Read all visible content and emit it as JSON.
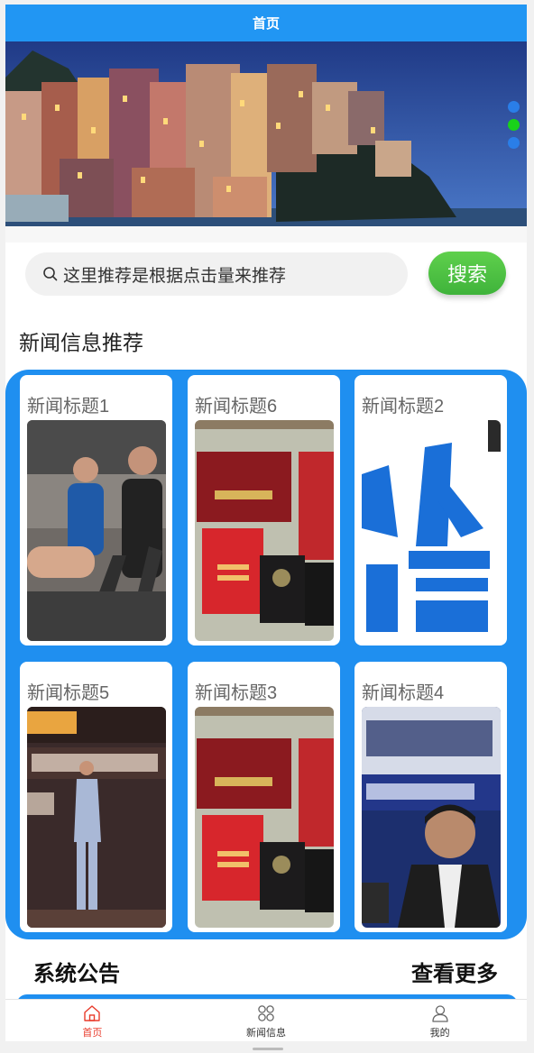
{
  "navbar": {
    "title": "首页"
  },
  "banner": {
    "slide_count": 3,
    "active_index": 1,
    "colors": {
      "active_dot": "#19d219",
      "inactive_dot": "#2a7ee8"
    }
  },
  "search": {
    "placeholder": "这里推荐是根据点击量来推荐",
    "button_label": "搜索",
    "icon": "search-icon"
  },
  "news_section": {
    "title": "新闻信息推荐",
    "items": [
      {
        "title": "新闻标题1",
        "image": "gym-photo"
      },
      {
        "title": "新闻标题6",
        "image": "certificates-photo"
      },
      {
        "title": "新闻标题2",
        "image": "personal-info-text-graphic"
      },
      {
        "title": "新闻标题5",
        "image": "stage-speaker-photo"
      },
      {
        "title": "新闻标题3",
        "image": "certificates-photo"
      },
      {
        "title": "新闻标题4",
        "image": "press-conference-photo"
      }
    ]
  },
  "notice_section": {
    "title": "系统公告",
    "more_label": "查看更多"
  },
  "tabbar": {
    "items": [
      {
        "label": "首页",
        "icon": "home-icon",
        "active": true
      },
      {
        "label": "新闻信息",
        "icon": "grid-icon",
        "active": false
      },
      {
        "label": "我的",
        "icon": "user-icon",
        "active": false
      }
    ]
  },
  "colors": {
    "primary": "#2196f3",
    "panel": "#1f8ff0",
    "search_button": "#4cc242",
    "active_tab": "#e83b2b"
  }
}
